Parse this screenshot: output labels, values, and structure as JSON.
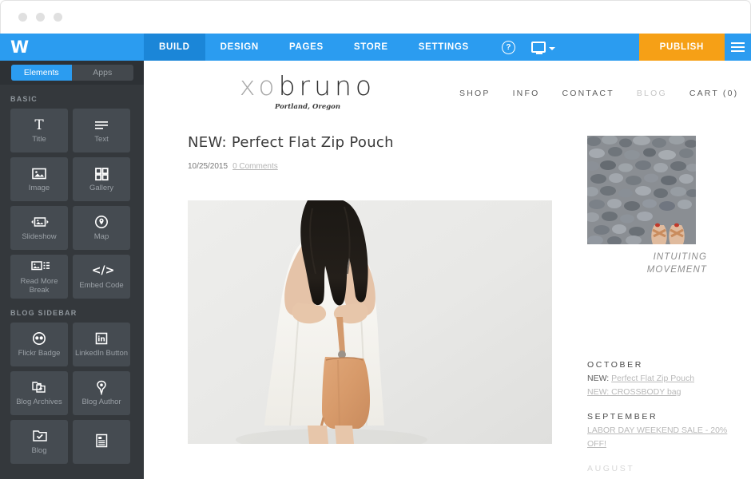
{
  "window": {
    "dots": [
      "close-dot",
      "minimize-dot",
      "zoom-dot"
    ]
  },
  "toolbar": {
    "logo_mark": "W",
    "tabs": [
      {
        "label": "BUILD",
        "active": true
      },
      {
        "label": "DESIGN",
        "active": false
      },
      {
        "label": "PAGES",
        "active": false
      },
      {
        "label": "STORE",
        "active": false
      },
      {
        "label": "SETTINGS",
        "active": false
      }
    ],
    "help_label": "?",
    "publish_label": "PUBLISH",
    "accent_blue": "#2b9cf0",
    "active_tab_blue": "#1b86d8",
    "publish_orange": "#f6a016"
  },
  "sidebar": {
    "segments": [
      {
        "label": "Elements",
        "active": true
      },
      {
        "label": "Apps",
        "active": false
      }
    ],
    "groups": [
      {
        "label": "BASIC",
        "items": [
          {
            "label": "Title",
            "icon": "title-icon"
          },
          {
            "label": "Text",
            "icon": "text-lines-icon"
          },
          {
            "label": "Image",
            "icon": "image-icon"
          },
          {
            "label": "Gallery",
            "icon": "gallery-grid-icon"
          },
          {
            "label": "Slideshow",
            "icon": "slideshow-icon"
          },
          {
            "label": "Map",
            "icon": "map-pin-icon"
          },
          {
            "label": "Read More Break",
            "icon": "read-more-break-icon"
          },
          {
            "label": "Embed Code",
            "icon": "embed-code-icon"
          }
        ]
      },
      {
        "label": "BLOG SIDEBAR",
        "items": [
          {
            "label": "Flickr Badge",
            "icon": "flickr-badge-icon"
          },
          {
            "label": "LinkedIn Button",
            "icon": "linkedin-icon"
          },
          {
            "label": "Blog Archives",
            "icon": "blog-archives-icon"
          },
          {
            "label": "Blog Author",
            "icon": "blog-author-pen-icon"
          },
          {
            "label": "Blog",
            "icon": "blog-folder-icon"
          },
          {
            "label": "",
            "icon": "recent-posts-icon"
          }
        ]
      }
    ]
  },
  "site": {
    "brand": {
      "name_light": "xo",
      "name_dark": "bruno",
      "tagline": "Portland, Oregon"
    },
    "nav": [
      {
        "label": "SHOP",
        "muted": false
      },
      {
        "label": "INFO",
        "muted": false
      },
      {
        "label": "CONTACT",
        "muted": false
      },
      {
        "label": "BLOG",
        "muted": true
      },
      {
        "label": "CART (0)",
        "muted": false
      }
    ],
    "post": {
      "title": "NEW: Perfect Flat Zip Pouch",
      "date": "10/25/2015",
      "comments": "0 Comments",
      "photo_alt": "woman-in-white-dress-holding-tan-leather-pouch"
    },
    "blog_sidebar": {
      "photo_alt": "feet-in-sandals-on-gray-pebbles",
      "caption_line1": "INTUITING",
      "caption_line2": "MOVEMENT",
      "archives": [
        {
          "month": "OCTOBER",
          "entries": [
            {
              "prefix": "NEW: ",
              "link": "Perfect Flat Zip Pouch"
            },
            {
              "prefix": "",
              "link": "NEW: CROSSBODY bag"
            }
          ]
        },
        {
          "month": "SEPTEMBER",
          "entries": [
            {
              "prefix": "",
              "link": "LABOR DAY WEEKEND SALE - 20% OFF!"
            }
          ]
        },
        {
          "month": "AUGUST",
          "entries": []
        }
      ]
    }
  }
}
